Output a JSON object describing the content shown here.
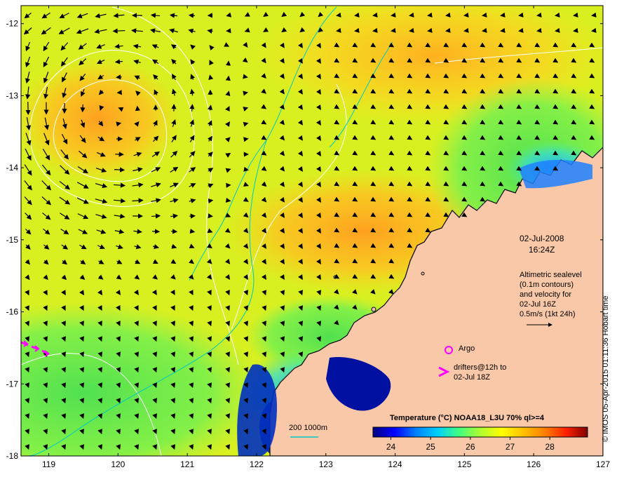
{
  "map": {
    "x_ticks": [
      "119",
      "120",
      "121",
      "122",
      "123",
      "124",
      "125",
      "126",
      "127"
    ],
    "y_ticks": [
      "-12",
      "-13",
      "-14",
      "-15",
      "-16",
      "-17",
      "-18"
    ],
    "lon_range": [
      118.6,
      127
    ],
    "lat_range": [
      -18,
      -11.75
    ]
  },
  "annotations": {
    "date": "02-Jul-2008",
    "time": "16:24Z",
    "alt_line1": "Altimetric sealevel",
    "alt_line2": "(0.1m contours)",
    "alt_line3": "and velocity for",
    "alt_line4": "02-Jul 16Z",
    "speed_scale": "0.5m/s (1kt 24h)",
    "argo_label": "Argo",
    "drifter_line1": "drifters@12h to",
    "drifter_line2": "02-Jul 18Z",
    "bathy_label": "200  1000m"
  },
  "colorbar": {
    "title": "Temperature (°C) NOAA18_L3U 70% ql>=4",
    "ticks": [
      "24",
      "25",
      "26",
      "27",
      "28"
    ],
    "colors": [
      "#00007f",
      "#0000ff",
      "#0080ff",
      "#00d0ff",
      "#40ff80",
      "#b0ff30",
      "#ffff00",
      "#ffc000",
      "#ff8000",
      "#ff2000",
      "#7f0000"
    ]
  },
  "credit": "© IMOS 05-Apr-2015 01:11:36 Hobart time",
  "colors": {
    "land": "#f8c8a8",
    "land_edge": "#000000",
    "contour": "#ffffff",
    "bathy": "#00c8c8",
    "argo": "#ff00ff"
  }
}
